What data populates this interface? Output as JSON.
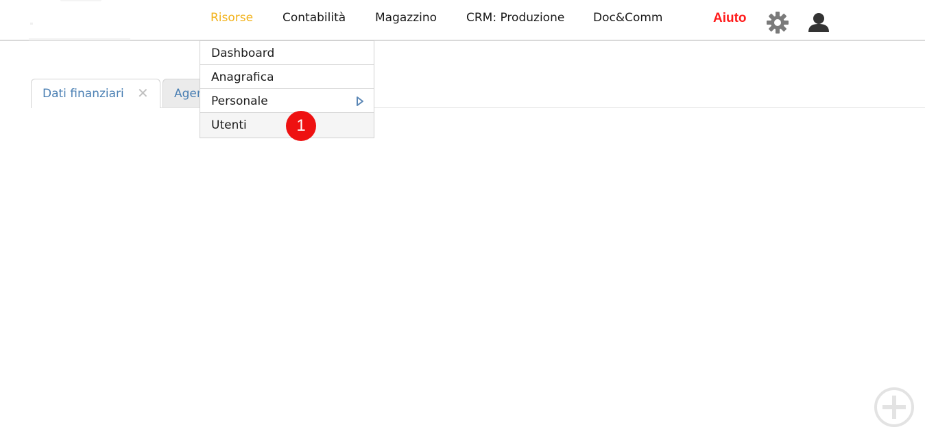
{
  "nav": {
    "items": [
      {
        "label": "Risorse",
        "active": true
      },
      {
        "label": "Contabilità"
      },
      {
        "label": "Magazzino"
      },
      {
        "label": "CRM: Produzione"
      },
      {
        "label": "Doc&Comm"
      }
    ],
    "help_label": "Aiuto",
    "settings_icon": "gear-icon",
    "user_icon": "user-icon"
  },
  "tabs": [
    {
      "label": "Dati finanziari",
      "active": true,
      "close_glyph": "✕"
    },
    {
      "label": "Agen"
    }
  ],
  "dropdown": {
    "items": [
      {
        "label": "Dashboard"
      },
      {
        "label": "Anagrafica"
      },
      {
        "label": "Personale",
        "has_submenu": true
      },
      {
        "label": "Utenti",
        "hovered": true
      }
    ]
  },
  "annotation": {
    "number": "1",
    "color": "#ee1111"
  },
  "fab_icon": "add-circle-icon",
  "colors": {
    "active_nav": "#f2b21b",
    "help": "#ff1a1a",
    "tab_text": "#4a7fb3"
  }
}
